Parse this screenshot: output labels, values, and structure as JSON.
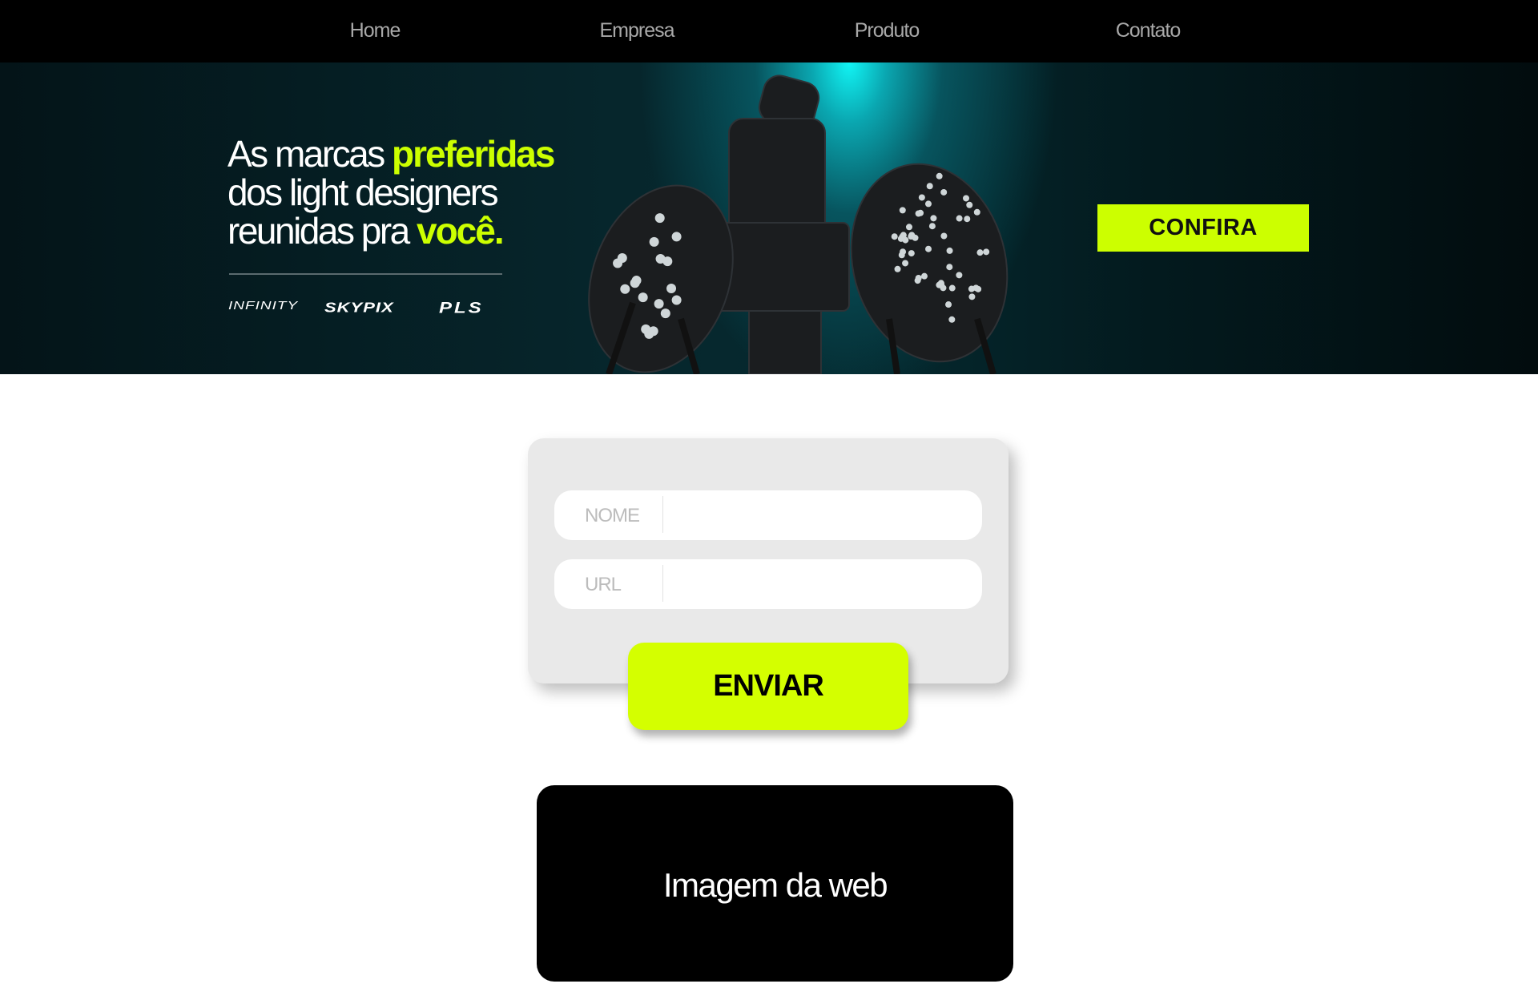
{
  "nav": {
    "items": [
      {
        "label": "Home"
      },
      {
        "label": "Empresa"
      },
      {
        "label": "Produto"
      },
      {
        "label": "Contato"
      }
    ]
  },
  "banner": {
    "headline_line1": "As marcas ",
    "headline_line1_hl": "preferidas",
    "headline_line2": "dos light designers",
    "headline_line3": "reunidas pra ",
    "headline_line3_hl": "você.",
    "brands": [
      "INFINITY",
      "SKYPIX",
      "PLS"
    ],
    "cta_label": "CONFIRA",
    "accent": "#ccff00"
  },
  "form": {
    "name_label": "NOME",
    "url_label": "URL",
    "submit_label": "ENVIAR",
    "submit_color": "#d4ff00"
  },
  "web_image": {
    "label": "Imagem da web"
  }
}
